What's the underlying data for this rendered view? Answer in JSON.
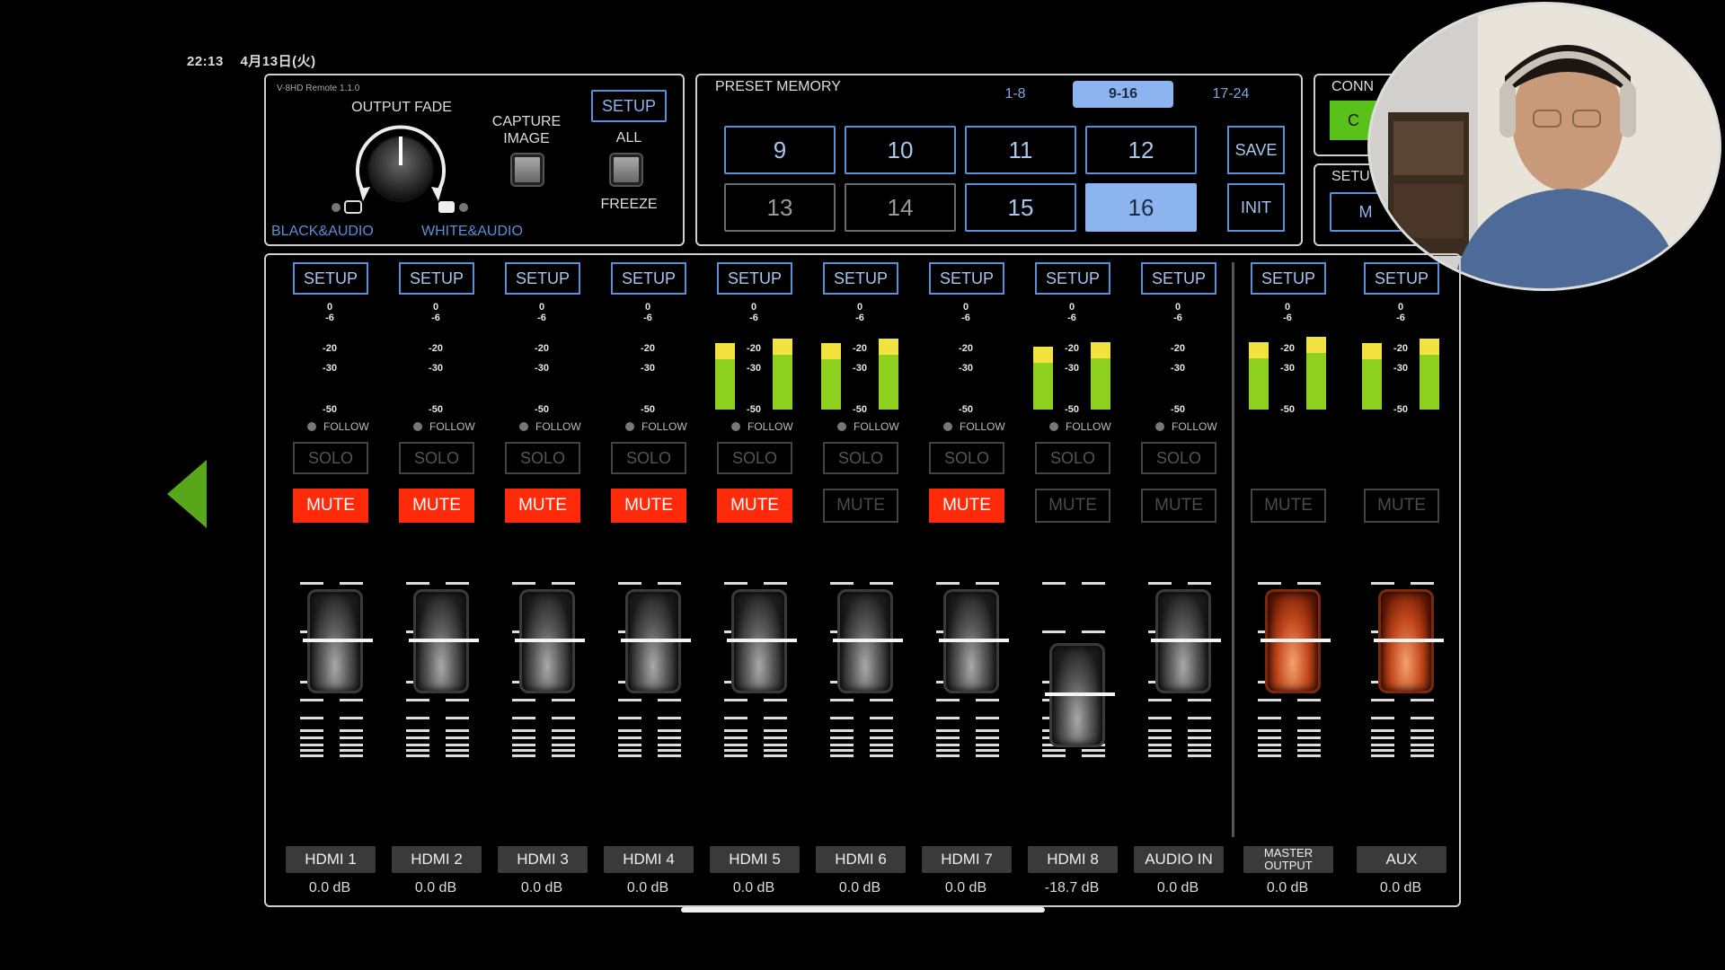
{
  "status_bar": {
    "time": "22:13",
    "date": "4月13日(火)"
  },
  "fade_panel": {
    "app_version": "V-8HD Remote 1.1.0",
    "output_fade_label": "OUTPUT FADE",
    "capture_label_1": "CAPTURE",
    "capture_label_2": "IMAGE",
    "setup_label": "SETUP",
    "all_label": "ALL",
    "freeze_label": "FREEZE",
    "black_audio_label": "BLACK&AUDIO",
    "white_audio_label": "WHITE&AUDIO"
  },
  "preset": {
    "title": "PRESET MEMORY",
    "ranges": [
      "1-8",
      "9-16",
      "17-24"
    ],
    "active_range": "9-16",
    "buttons": [
      "9",
      "10",
      "11",
      "12",
      "13",
      "14",
      "15",
      "16"
    ],
    "active_button": "16",
    "save_label": "SAVE",
    "init_label": "INIT"
  },
  "connection_panel": {
    "title_fragment": "CONN",
    "button_fragment": "C",
    "setup_fragment": "SETU",
    "button2_fragment": "M"
  },
  "meter_scale": [
    "0",
    "-6",
    "-20",
    "-30",
    "-50"
  ],
  "follow_label": "FOLLOW",
  "solo_label": "SOLO",
  "mute_label": "MUTE",
  "setup_label": "SETUP",
  "channels": [
    {
      "name": "HDMI 1",
      "db": "0.0 dB",
      "muted": true,
      "meter_level": 0,
      "fader_level": 0.8
    },
    {
      "name": "HDMI 2",
      "db": "0.0 dB",
      "muted": true,
      "meter_level": 0,
      "fader_level": 0.8
    },
    {
      "name": "HDMI 3",
      "db": "0.0 dB",
      "muted": true,
      "meter_level": 0,
      "fader_level": 0.8
    },
    {
      "name": "HDMI 4",
      "db": "0.0 dB",
      "muted": true,
      "meter_level": 0,
      "fader_level": 0.8
    },
    {
      "name": "HDMI 5",
      "db": "0.0 dB",
      "muted": true,
      "meter_level": 0.9,
      "fader_level": 0.8
    },
    {
      "name": "HDMI 6",
      "db": "0.0 dB",
      "muted": false,
      "meter_level": 0.9,
      "fader_level": 0.8
    },
    {
      "name": "HDMI 7",
      "db": "0.0 dB",
      "muted": true,
      "meter_level": 0,
      "fader_level": 0.8
    },
    {
      "name": "HDMI 8",
      "db": "-18.7 dB",
      "muted": false,
      "meter_level": 0.85,
      "fader_level": 0.55
    },
    {
      "name": "AUDIO IN",
      "db": "0.0 dB",
      "muted": false,
      "meter_level": 0,
      "fader_level": 0.8
    },
    {
      "name": "MASTER OUTPUT",
      "db": "0.0 dB",
      "muted": false,
      "meter_level": 0.92,
      "fader_level": 0.8
    },
    {
      "name": "AUX",
      "db": "0.0 dB",
      "muted": false,
      "meter_level": 0.9,
      "fader_level": 0.8
    }
  ],
  "colors": {
    "accent_blue": "#5b8fd8",
    "mute_red": "#ff2a0a",
    "meter_green": "#8ed11f",
    "meter_yellow": "#f2e341",
    "back_arrow": "#58a61a"
  }
}
